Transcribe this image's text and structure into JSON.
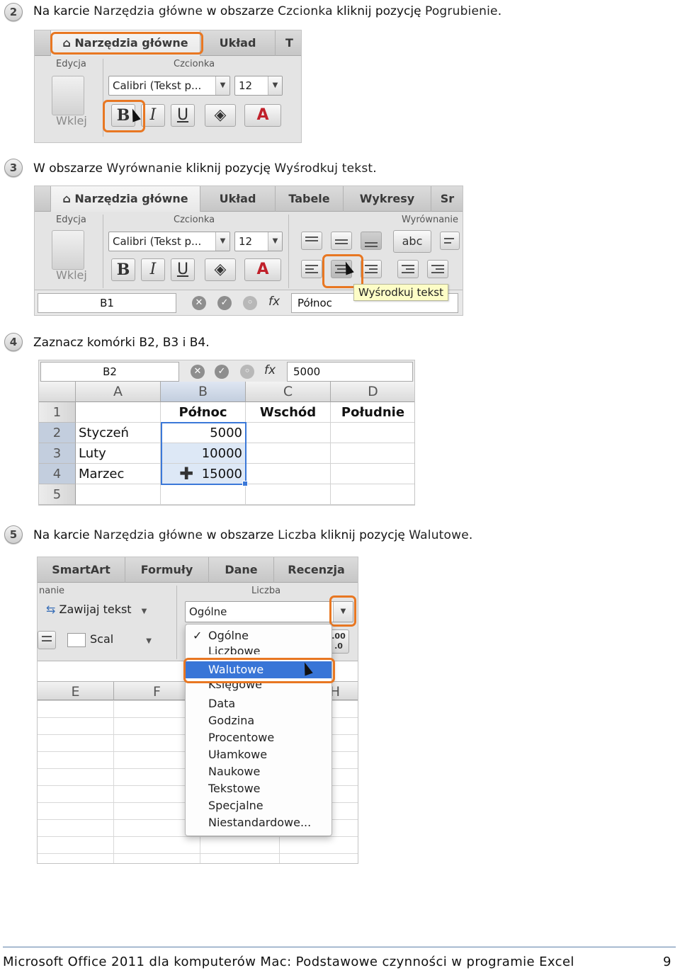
{
  "steps": [
    {
      "num": "2",
      "parts": [
        "Na karcie ",
        "Narzędzia główne",
        " w obszarze ",
        "Czcionka",
        " kliknij pozycję ",
        "Pogrubienie",
        "."
      ]
    },
    {
      "num": "3",
      "parts": [
        "W obszarze ",
        "Wyrównanie",
        " kliknij pozycję ",
        "Wyśrodkuj tekst",
        "."
      ]
    },
    {
      "num": "4",
      "parts": [
        "Zaznacz komórki B2, B3 i B4."
      ]
    },
    {
      "num": "5",
      "parts": [
        "Na karcie ",
        "Narzędzia główne",
        " w obszarze ",
        "Liczba",
        " kliknij pozycję ",
        "Walutowe",
        "."
      ]
    }
  ],
  "shot1": {
    "tabs": [
      "Narzędzia główne",
      "Układ",
      "T"
    ],
    "groups": {
      "edit": "Edycja",
      "font": "Czcionka"
    },
    "font_name": "Calibri (Tekst p...",
    "font_size": "12",
    "paste": "Wklej",
    "bold": "B",
    "italic": "I",
    "underline": "U",
    "fontcolor": "A"
  },
  "shot2": {
    "tabs": [
      "Narzędzia główne",
      "Układ",
      "Tabele",
      "Wykresy",
      "Sr"
    ],
    "groups": {
      "edit": "Edycja",
      "font": "Czcionka",
      "align": "Wyrównanie"
    },
    "font_name": "Calibri (Tekst p...",
    "font_size": "12",
    "paste": "Wklej",
    "bold": "B",
    "italic": "I",
    "underline": "U",
    "fontcolor": "A",
    "abc": "abc",
    "namebox": "B1",
    "fx": "fx",
    "formula": "Północ",
    "tooltip": "Wyśrodkuj tekst"
  },
  "shot3": {
    "namebox": "B2",
    "fx": "fx",
    "formula": "5000",
    "columns": [
      "A",
      "B",
      "C",
      "D"
    ],
    "rows": [
      {
        "n": "1",
        "a": "",
        "b": "Północ",
        "c": "Wschód",
        "d": "Południe"
      },
      {
        "n": "2",
        "a": "Styczeń",
        "b": "5000",
        "c": "",
        "d": ""
      },
      {
        "n": "3",
        "a": "Luty",
        "b": "10000",
        "c": "",
        "d": ""
      },
      {
        "n": "4",
        "a": "Marzec",
        "b": "15000",
        "c": "",
        "d": ""
      },
      {
        "n": "5",
        "a": "",
        "b": "",
        "c": "",
        "d": ""
      }
    ]
  },
  "shot4": {
    "tabs": [
      "SmartArt",
      "Formuły",
      "Dane",
      "Recenzja"
    ],
    "group_left": "nanie",
    "group_number": "Liczba",
    "wrap": "Zawijaj tekst",
    "merge": "Scal",
    "format_value": "Ogólne",
    "columns": [
      "E",
      "F",
      "H"
    ],
    "menu": [
      "Ogólne",
      "Liczbowe",
      "Walutowe",
      "Księgowe",
      "Data",
      "Godzina",
      "Procentowe",
      "Ułamkowe",
      "Naukowe",
      "Tekstowe",
      "Specjalne",
      "Niestandardowe..."
    ],
    "menu_checked": "✓",
    "menu_selected": "Walutowe",
    "dec_buttons": [
      ".00",
      ".0"
    ]
  },
  "footer": {
    "title": "Microsoft Office 2011 dla komputerów Mac: Podstawowe czynności w programie Excel",
    "page": "9"
  },
  "colors": {
    "highlight": "#e87722",
    "selection": "#3b78d8",
    "menu_selected": "#3875d7"
  }
}
